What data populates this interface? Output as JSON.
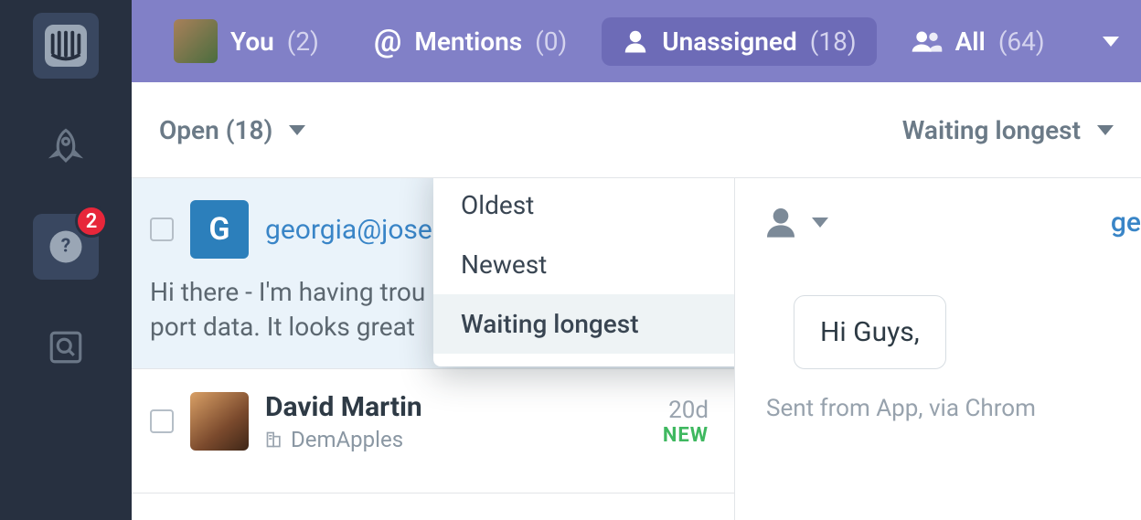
{
  "rail": {
    "badge": "2"
  },
  "tabs": {
    "you": {
      "label": "You",
      "count": "(2)"
    },
    "mentions": {
      "label": "Mentions",
      "count": "(0)",
      "glyph": "@"
    },
    "unassigned": {
      "label": "Unassigned",
      "count": "(18)"
    },
    "all": {
      "label": "All",
      "count": "(64)"
    }
  },
  "filters": {
    "status": "Open (18)",
    "sort": "Waiting longest"
  },
  "sort_menu": {
    "opt0": "Oldest",
    "opt1": "Newest",
    "opt2": "Waiting longest"
  },
  "rows": {
    "r0": {
      "initial": "G",
      "name": "georgia@josep",
      "preview": "Hi there - I'm having trou\nport data. It looks great"
    },
    "r1": {
      "name": "David Martin",
      "company": "DemApples",
      "age": "20d",
      "badge": "NEW"
    }
  },
  "detail": {
    "name": "ge",
    "bubble": "Hi Guys,",
    "meta": "Sent from App, via Chrom"
  }
}
